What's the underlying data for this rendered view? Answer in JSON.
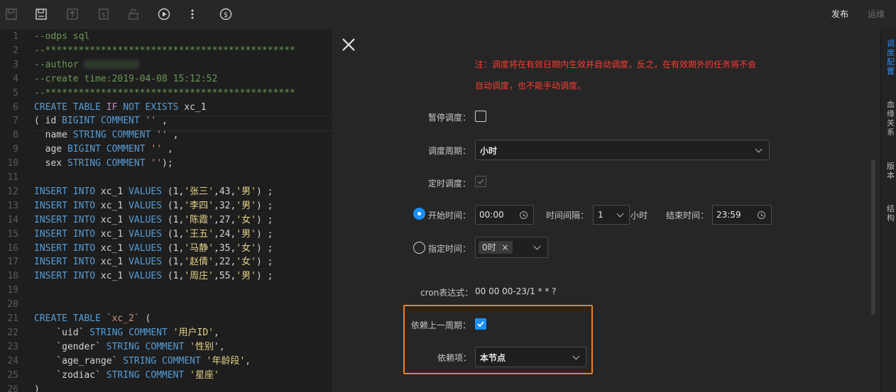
{
  "toolbar": {
    "publish_label": "发布",
    "ops_label": "运维"
  },
  "editor": {
    "lines": [
      {
        "n": "1",
        "segs": [
          [
            "cm",
            "--odps sql"
          ]
        ]
      },
      {
        "n": "2",
        "segs": [
          [
            "cm",
            "--*********************************************"
          ]
        ]
      },
      {
        "n": "3",
        "segs": [
          [
            "cm",
            "--author "
          ]
        ]
      },
      {
        "n": "4",
        "segs": [
          [
            "cm",
            "--create time:2019-04-08 15:12:52"
          ]
        ]
      },
      {
        "n": "5",
        "segs": [
          [
            "cm",
            "--*********************************************"
          ]
        ]
      },
      {
        "n": "6",
        "segs": [
          [
            "kw",
            "CREATE TABLE "
          ],
          [
            "kw2",
            "IF"
          ],
          [
            "kw",
            " NOT EXISTS "
          ],
          [
            "id",
            "xc_1"
          ]
        ]
      },
      {
        "n": "7",
        "segs": [
          [
            "id",
            "( id "
          ],
          [
            "kw",
            "BIGINT COMMENT "
          ],
          [
            "str",
            "''"
          ],
          [
            "id",
            " ,"
          ]
        ]
      },
      {
        "n": "8",
        "segs": [
          [
            "id",
            "  name "
          ],
          [
            "kw",
            "STRING COMMENT "
          ],
          [
            "str",
            "''"
          ],
          [
            "id",
            " ,"
          ]
        ]
      },
      {
        "n": "9",
        "segs": [
          [
            "id",
            "  age "
          ],
          [
            "kw",
            "BIGINT COMMENT "
          ],
          [
            "str",
            "''"
          ],
          [
            "id",
            " ,"
          ]
        ]
      },
      {
        "n": "10",
        "segs": [
          [
            "id",
            "  sex "
          ],
          [
            "kw",
            "STRING COMMENT "
          ],
          [
            "str",
            "''"
          ],
          [
            "id",
            ");"
          ]
        ]
      },
      {
        "n": "11",
        "segs": []
      },
      {
        "n": "12",
        "segs": [
          [
            "kw",
            "INSERT INTO "
          ],
          [
            "id",
            "xc_1 "
          ],
          [
            "kw",
            "VALUES "
          ],
          [
            "id",
            "(1,"
          ],
          [
            "zh",
            "'张三'"
          ],
          [
            "id",
            ",43,"
          ],
          [
            "zh",
            "'男'"
          ],
          [
            "id",
            ") ;"
          ]
        ]
      },
      {
        "n": "13",
        "segs": [
          [
            "kw",
            "INSERT INTO "
          ],
          [
            "id",
            "xc_1 "
          ],
          [
            "kw",
            "VALUES "
          ],
          [
            "id",
            "(1,"
          ],
          [
            "zh",
            "'李四'"
          ],
          [
            "id",
            ",32,"
          ],
          [
            "zh",
            "'男'"
          ],
          [
            "id",
            ") ;"
          ]
        ]
      },
      {
        "n": "14",
        "segs": [
          [
            "kw",
            "INSERT INTO "
          ],
          [
            "id",
            "xc_1 "
          ],
          [
            "kw",
            "VALUES "
          ],
          [
            "id",
            "(1,"
          ],
          [
            "zh",
            "'陈霞'"
          ],
          [
            "id",
            ",27,"
          ],
          [
            "zh",
            "'女'"
          ],
          [
            "id",
            ") ;"
          ]
        ]
      },
      {
        "n": "15",
        "segs": [
          [
            "kw",
            "INSERT INTO "
          ],
          [
            "id",
            "xc_1 "
          ],
          [
            "kw",
            "VALUES "
          ],
          [
            "id",
            "(1,"
          ],
          [
            "zh",
            "'王五'"
          ],
          [
            "id",
            ",24,"
          ],
          [
            "zh",
            "'男'"
          ],
          [
            "id",
            ") ;"
          ]
        ]
      },
      {
        "n": "16",
        "segs": [
          [
            "kw",
            "INSERT INTO "
          ],
          [
            "id",
            "xc_1 "
          ],
          [
            "kw",
            "VALUES "
          ],
          [
            "id",
            "(1,"
          ],
          [
            "zh",
            "'马静'"
          ],
          [
            "id",
            ",35,"
          ],
          [
            "zh",
            "'女'"
          ],
          [
            "id",
            ") ;"
          ]
        ]
      },
      {
        "n": "17",
        "segs": [
          [
            "kw",
            "INSERT INTO "
          ],
          [
            "id",
            "xc_1 "
          ],
          [
            "kw",
            "VALUES "
          ],
          [
            "id",
            "(1,"
          ],
          [
            "zh",
            "'赵倩'"
          ],
          [
            "id",
            ",22,"
          ],
          [
            "zh",
            "'女'"
          ],
          [
            "id",
            ") ;"
          ]
        ]
      },
      {
        "n": "18",
        "segs": [
          [
            "kw",
            "INSERT INTO "
          ],
          [
            "id",
            "xc_1 "
          ],
          [
            "kw",
            "VALUES "
          ],
          [
            "id",
            "(1,"
          ],
          [
            "zh",
            "'周庄'"
          ],
          [
            "id",
            ",55,"
          ],
          [
            "zh",
            "'男'"
          ],
          [
            "id",
            ") ;"
          ]
        ]
      },
      {
        "n": "19",
        "segs": []
      },
      {
        "n": "20",
        "segs": []
      },
      {
        "n": "21",
        "segs": [
          [
            "kw",
            "CREATE TABLE "
          ],
          [
            "str",
            "`xc_2`"
          ],
          [
            "id",
            " ("
          ]
        ]
      },
      {
        "n": "22",
        "segs": [
          [
            "id",
            "    `uid` "
          ],
          [
            "kw",
            "STRING COMMENT "
          ],
          [
            "zh",
            "'用户ID'"
          ],
          [
            "id",
            ","
          ]
        ]
      },
      {
        "n": "23",
        "segs": [
          [
            "id",
            "    `gender` "
          ],
          [
            "kw",
            "STRING COMMENT "
          ],
          [
            "zh",
            "'性别'"
          ],
          [
            "id",
            ","
          ]
        ]
      },
      {
        "n": "24",
        "segs": [
          [
            "id",
            "    `age_range` "
          ],
          [
            "kw",
            "STRING COMMENT "
          ],
          [
            "zh",
            "'年龄段'"
          ],
          [
            "id",
            ","
          ]
        ]
      },
      {
        "n": "25",
        "segs": [
          [
            "id",
            "    `zodiac` "
          ],
          [
            "kw",
            "STRING COMMENT "
          ],
          [
            "zh",
            "'星座'"
          ]
        ]
      },
      {
        "n": "26",
        "segs": [
          [
            "id",
            ")"
          ]
        ]
      }
    ]
  },
  "schedule": {
    "note_line1": "注：调度将在有效日期内生效并自动调度，反之，在有效期外的任务将不会",
    "note_line2": "自动调度，也不能手动调度。",
    "pause_label": "暂停调度：",
    "period_label": "调度周期：",
    "period_value": "小时",
    "timed_label": "定时调度：",
    "start_time_label": "开始时间：",
    "start_time_value": "00:00",
    "interval_label": "时间间隔：",
    "interval_value": "1",
    "interval_unit": "小时",
    "end_time_label": "结束时间：",
    "end_time_value": "23:59",
    "specified_time_label": "指定时间：",
    "specified_tag": "0时",
    "specified_tag_remove": "×",
    "cron_label": "cron表达式：",
    "cron_value": "00 00 00-23/1 * * ?",
    "depend_prev_label": "依赖上一周期：",
    "depend_item_label": "依赖项：",
    "depend_item_value": "本节点"
  },
  "sidebar": {
    "tabs": [
      "调度配置",
      "血缘关系",
      "版本",
      "结构"
    ]
  },
  "colors": {
    "accent": "#1890ff",
    "note_red": "#ff3a30",
    "highlight_orange": "#f0801d"
  }
}
